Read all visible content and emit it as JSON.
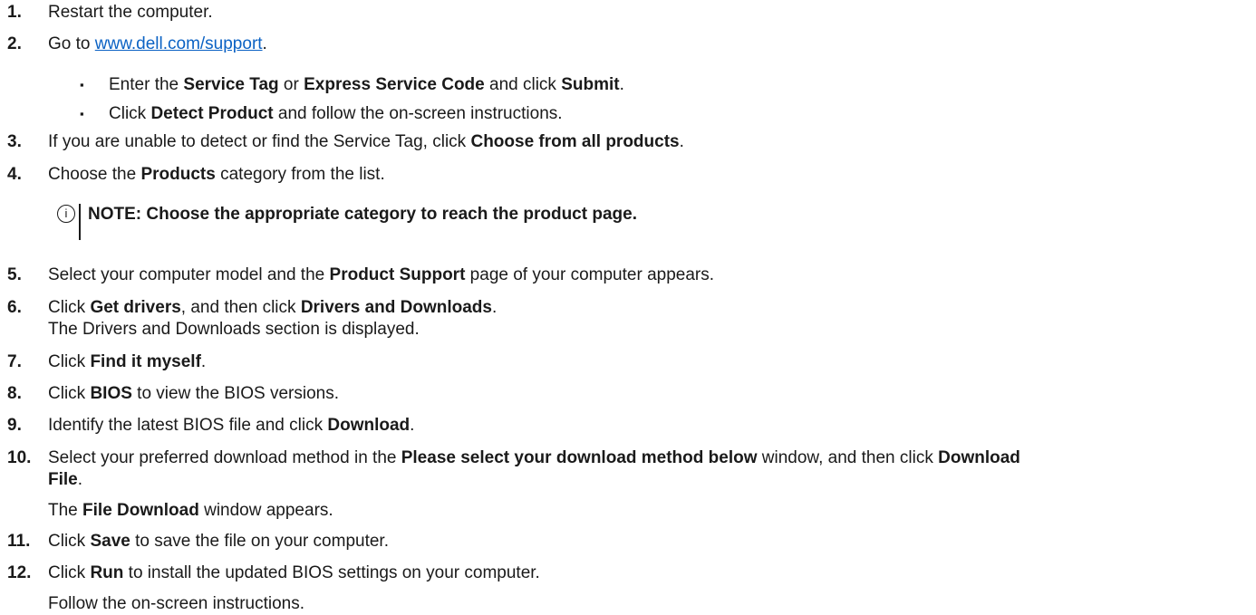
{
  "steps": {
    "s1": {
      "num": "1.",
      "text": "Restart the computer."
    },
    "s2": {
      "num": "2.",
      "pre": "Go to ",
      "link": "www.dell.com/support",
      "post": "."
    },
    "b1": {
      "a": "Enter the ",
      "b": "Service Tag",
      "c": " or ",
      "d": "Express Service Code",
      "e": " and click ",
      "f": "Submit",
      "g": "."
    },
    "b2": {
      "a": "Click ",
      "b": "Detect Product",
      "c": " and follow the on-screen instructions."
    },
    "s3": {
      "num": "3.",
      "a": "If you are unable to detect or find the Service Tag, click ",
      "b": "Choose from all products",
      "c": "."
    },
    "s4": {
      "num": "4.",
      "a": "Choose the ",
      "b": "Products",
      "c": " category from the list."
    },
    "note": {
      "icon": "i",
      "text": "NOTE: Choose the appropriate category to reach the product page."
    },
    "s5": {
      "num": "5.",
      "a": "Select your computer model and the ",
      "b": "Product Support",
      "c": " page of your computer appears."
    },
    "s6": {
      "num": "6.",
      "a": "Click ",
      "b": "Get drivers",
      "c": ", and then click ",
      "d": "Drivers and Downloads",
      "e": ".",
      "line2": "The Drivers and Downloads section is displayed."
    },
    "s7": {
      "num": "7.",
      "a": "Click ",
      "b": "Find it myself",
      "c": "."
    },
    "s8": {
      "num": "8.",
      "a": "Click ",
      "b": "BIOS",
      "c": " to view the BIOS versions."
    },
    "s9": {
      "num": "9.",
      "a": "Identify the latest BIOS file and click ",
      "b": "Download",
      "c": "."
    },
    "s10": {
      "num": "10.",
      "a": "Select your preferred download method in the ",
      "b": "Please select your download method below",
      "c": " window, and then click ",
      "d": "Download",
      "e": "File",
      "f": ".",
      "g": "The ",
      "h": "File Download",
      "i": " window appears."
    },
    "s11": {
      "num": "11.",
      "a": "Click ",
      "b": "Save",
      "c": " to save the file on your computer."
    },
    "s12": {
      "num": "12.",
      "a": "Click ",
      "b": "Run",
      "c": " to install the updated BIOS settings on your computer.",
      "line2": "Follow the on-screen instructions."
    }
  }
}
